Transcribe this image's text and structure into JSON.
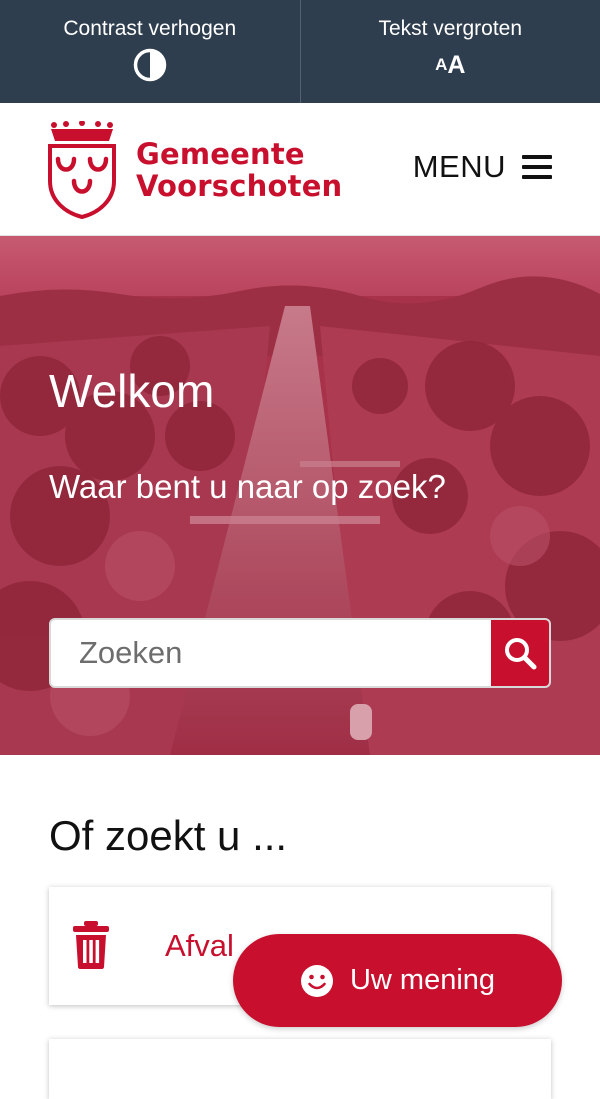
{
  "a11y": {
    "contrast_label": "Contrast verhogen",
    "textsize_label": "Tekst vergroten",
    "textsize_icon_small": "A",
    "textsize_icon_big": "A"
  },
  "header": {
    "logo_line1": "Gemeente",
    "logo_line2": "Voorschoten",
    "menu_label": "MENU"
  },
  "hero": {
    "title": "Welkom",
    "subtitle": "Waar bent u naar op zoek?",
    "search_placeholder": "Zoeken"
  },
  "section": {
    "title": "Of zoekt u ...",
    "cards": [
      {
        "label": "Afval",
        "icon": "trash-icon"
      }
    ]
  },
  "feedback": {
    "label": "Uw mening",
    "icon": "smiley-icon"
  },
  "colors": {
    "brand": "#c8102e",
    "topbar": "#2f3e4e"
  }
}
